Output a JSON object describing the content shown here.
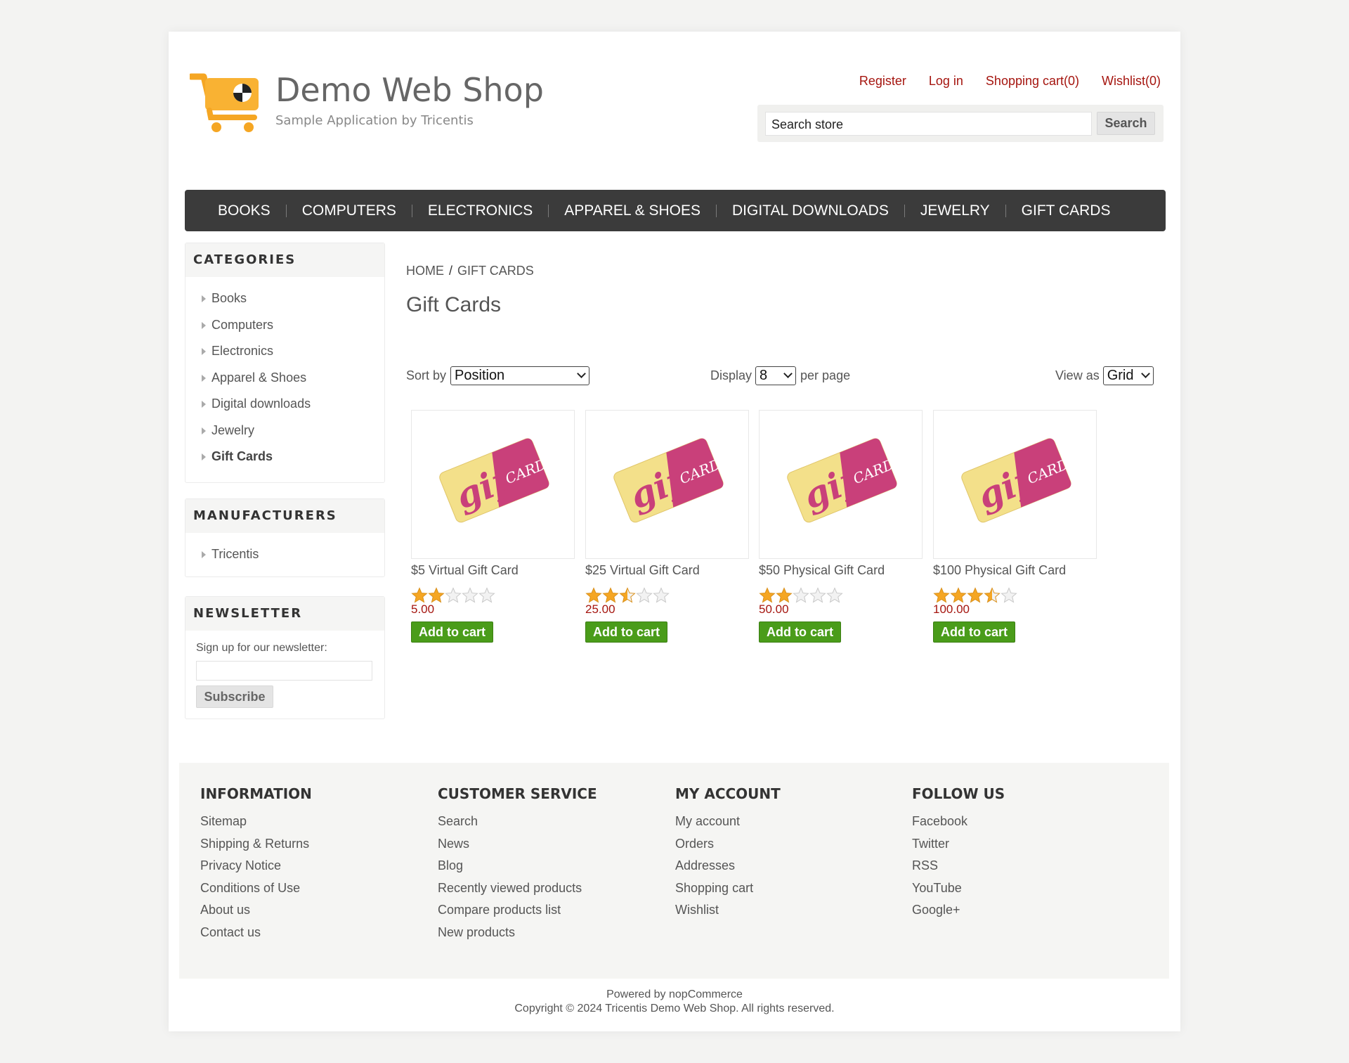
{
  "header": {
    "logo_title": "Demo Web Shop",
    "logo_subtitle": "Sample Application by Tricentis",
    "links": [
      "Register",
      "Log in",
      "Shopping cart(0)",
      "Wishlist(0)"
    ],
    "search_placeholder": "Search store",
    "search_button": "Search"
  },
  "top_menu": [
    "BOOKS",
    "COMPUTERS",
    "ELECTRONICS",
    "APPAREL & SHOES",
    "DIGITAL DOWNLOADS",
    "JEWELRY",
    "GIFT CARDS"
  ],
  "categories": {
    "title": "CATEGORIES",
    "items": [
      "Books",
      "Computers",
      "Electronics",
      "Apparel & Shoes",
      "Digital downloads",
      "Jewelry",
      "Gift Cards"
    ],
    "active": "Gift Cards"
  },
  "manufacturers": {
    "title": "MANUFACTURERS",
    "items": [
      "Tricentis"
    ]
  },
  "newsletter": {
    "title": "NEWSLETTER",
    "label": "Sign up for our newsletter:",
    "button": "Subscribe"
  },
  "breadcrumb": {
    "home": "HOME",
    "separator": "/",
    "current": "GIFT CARDS"
  },
  "page_title": "Gift Cards",
  "pager": {
    "sort_label": "Sort by",
    "sort_value": "Position",
    "display_label": "Display",
    "display_value": "8",
    "per_page_label": "per page",
    "view_label": "View as",
    "view_value": "Grid"
  },
  "products": [
    {
      "name": "$5 Virtual Gift Card",
      "rating": 2,
      "price": "5.00",
      "button": "Add to cart",
      "image_text": [
        "gift",
        "CARD"
      ]
    },
    {
      "name": "$25 Virtual Gift Card",
      "rating": 2.5,
      "price": "25.00",
      "button": "Add to cart",
      "image_text": [
        "gift",
        "CARD"
      ]
    },
    {
      "name": "$50 Physical Gift Card",
      "rating": 2,
      "price": "50.00",
      "button": "Add to cart",
      "image_text": [
        "gift",
        "CARD"
      ]
    },
    {
      "name": "$100 Physical Gift Card",
      "rating": 3.5,
      "price": "100.00",
      "button": "Add to cart",
      "image_text": [
        "gift",
        "CARD"
      ]
    }
  ],
  "footer": {
    "columns": [
      {
        "title": "INFORMATION",
        "items": [
          "Sitemap",
          "Shipping & Returns",
          "Privacy Notice",
          "Conditions of Use",
          "About us",
          "Contact us"
        ]
      },
      {
        "title": "CUSTOMER SERVICE",
        "items": [
          "Search",
          "News",
          "Blog",
          "Recently viewed products",
          "Compare products list",
          "New products"
        ]
      },
      {
        "title": "MY ACCOUNT",
        "items": [
          "My account",
          "Orders",
          "Addresses",
          "Shopping cart",
          "Wishlist"
        ]
      },
      {
        "title": "FOLLOW US",
        "items": [
          "Facebook",
          "Twitter",
          "RSS",
          "YouTube",
          "Google+"
        ]
      }
    ],
    "powered_by": "Powered by nopCommerce",
    "copyright": "Copyright © 2024 Tricentis Demo Web Shop. All rights reserved."
  },
  "colors": {
    "link_red": "#a5150f",
    "menu_bg": "#3b3b3b",
    "cart_button_green": "#4a9c1a",
    "star_gold": "#f5a623",
    "card_yellow": "#f3e08a",
    "card_pink": "#c9407a"
  }
}
